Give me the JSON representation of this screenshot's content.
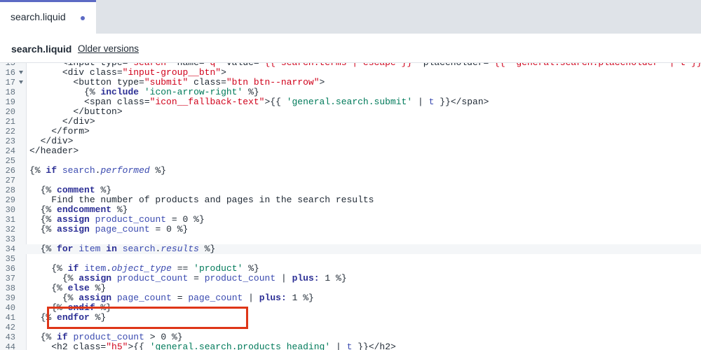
{
  "tab": {
    "label": "search.liquid"
  },
  "file_header": {
    "title": "search.liquid",
    "older_versions": "Older versions"
  },
  "colors": {
    "accent": "#5c6ac4",
    "highlight": "#de3618"
  },
  "editor": {
    "lines": [
      {
        "num": "15",
        "text": "      <input type=\"search\" name=\"q\" value=\"{{ search.terms | escape }}\" placeholder=\"{{ 'general.search.placeholder' | t }}\" class=\"input-group__field\">"
      },
      {
        "num": "16",
        "fold": true,
        "text": "      <div class=\"input-group__btn\">"
      },
      {
        "num": "17",
        "fold": true,
        "text": "        <button type=\"submit\" class=\"btn btn--narrow\">"
      },
      {
        "num": "18",
        "text": "          {% include 'icon-arrow-right' %}"
      },
      {
        "num": "19",
        "text": "          <span class=\"icon__fallback-text\">{{ 'general.search.submit' | t }}</span>"
      },
      {
        "num": "20",
        "text": "        </button>"
      },
      {
        "num": "21",
        "text": "      </div>"
      },
      {
        "num": "22",
        "text": "    </form>"
      },
      {
        "num": "23",
        "text": "  </div>"
      },
      {
        "num": "24",
        "text": "</header>"
      },
      {
        "num": "25",
        "text": ""
      },
      {
        "num": "26",
        "text": "{% if search.performed %}"
      },
      {
        "num": "27",
        "text": ""
      },
      {
        "num": "28",
        "text": "  {% comment %}"
      },
      {
        "num": "29",
        "text": "    Find the number of products and pages in the search results"
      },
      {
        "num": "30",
        "text": "  {% endcomment %}"
      },
      {
        "num": "31",
        "text": "  {% assign product_count = 0 %}"
      },
      {
        "num": "32",
        "text": "  {% assign page_count = 0 %}"
      },
      {
        "num": "33",
        "text": ""
      },
      {
        "num": "34",
        "text": "  {% for item in search.results %}"
      },
      {
        "num": "35",
        "text": ""
      },
      {
        "num": "36",
        "text": "    {% if item.object_type == 'product' %}"
      },
      {
        "num": "37",
        "text": "      {% assign product_count = product_count | plus: 1 %}"
      },
      {
        "num": "38",
        "text": "    {% else %}"
      },
      {
        "num": "39",
        "text": "      {% assign page_count = page_count | plus: 1 %}"
      },
      {
        "num": "40",
        "text": "    {% endif %}"
      },
      {
        "num": "41",
        "text": "  {% endfor %}"
      },
      {
        "num": "42",
        "text": ""
      },
      {
        "num": "43",
        "text": "  {% if product_count > 0 %}"
      },
      {
        "num": "44",
        "text": "    <h2 class=\"h5\">{{ 'general.search.products_heading' | t }}</h2>"
      }
    ]
  }
}
